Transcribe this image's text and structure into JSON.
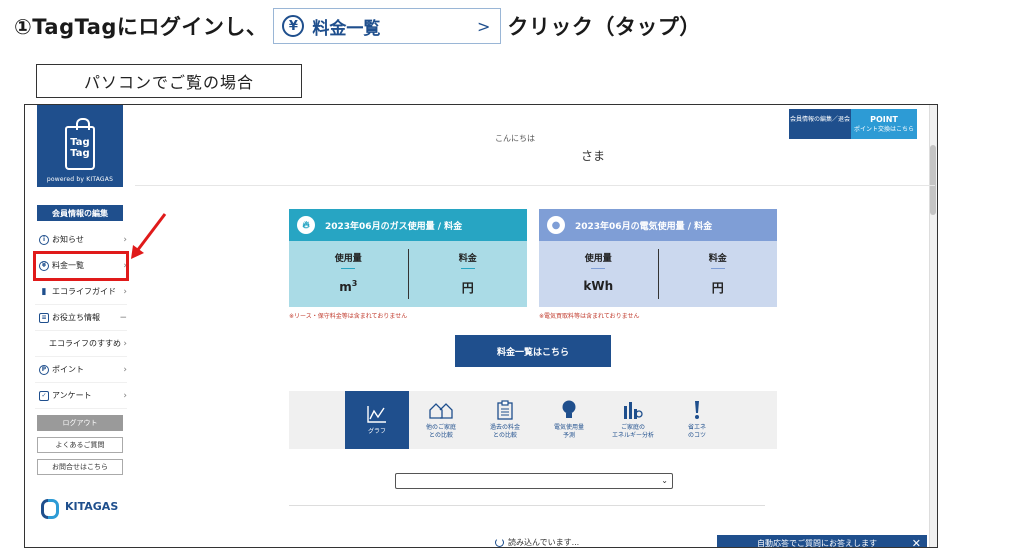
{
  "instruction": {
    "prefix": "①TagTagにログインし、",
    "button_label": "料金一覧",
    "button_chevron": ">",
    "suffix": "クリック（タップ）"
  },
  "pc_label": "パソコンでご覧の場合",
  "sidebar": {
    "logo_line1": "Tag",
    "logo_line2": "Tag",
    "powered": "powered by KITAGAS",
    "member_edit": "会員情報の編集",
    "items": [
      {
        "label": "お知らせ",
        "icon": "info-icon"
      },
      {
        "label": "料金一覧",
        "icon": "yen-icon"
      },
      {
        "label": "エコライフガイド",
        "icon": "bar-chart-icon"
      },
      {
        "label": "お役立ち情報",
        "icon": "document-icon",
        "marker": "−"
      },
      {
        "label": "エコライフのすすめ",
        "icon": ""
      },
      {
        "label": "ポイント",
        "icon": "point-icon"
      },
      {
        "label": "アンケート",
        "icon": "survey-icon"
      }
    ],
    "logout": "ログアウト",
    "faq": "よくあるご質問",
    "contact": "お問合せはこちら",
    "brand": "KITAGAS"
  },
  "header": {
    "member_btn": "会員情報の編集／退会",
    "point_btn_title": "POINT",
    "point_btn_sub": "ポイント交換はこちら",
    "greeting": "こんにちは",
    "name_suffix": "さま"
  },
  "gas_card": {
    "title": "2023年06月のガス使用量 / 料金",
    "usage_label": "使用量",
    "fee_label": "料金",
    "usage_unit": "m",
    "usage_sup": "3",
    "fee_unit": "円",
    "note": "※リース・保守料金等は含まれておりません"
  },
  "elec_card": {
    "title": "2023年06月の電気使用量 / 料金",
    "usage_label": "使用量",
    "fee_label": "料金",
    "usage_unit": "kWh",
    "fee_unit": "円",
    "note": "※電気買取料等は含まれておりません"
  },
  "main_button": "料金一覧はこちら",
  "tabs": [
    {
      "line1": "グラフ",
      "line2": "",
      "icon": "line-graph-icon"
    },
    {
      "line1": "他のご家庭",
      "line2": "との比較",
      "icon": "houses-icon"
    },
    {
      "line1": "過去の料金",
      "line2": "との比較",
      "icon": "clipboard-icon"
    },
    {
      "line1": "電気使用量",
      "line2": "予測",
      "icon": "bulb-icon"
    },
    {
      "line1": "ご家庭の",
      "line2": "エネルギー分析",
      "icon": "analysis-icon"
    },
    {
      "line1": "省エネ",
      "line2": "のコツ",
      "icon": "exclamation-icon"
    }
  ],
  "loading": "読み込んでいます...",
  "chat": "自動応答でご質問にお答えします",
  "chat_close": "✕",
  "colors": {
    "brand_navy": "#1f4f8d",
    "gas_teal": "#27a5c3",
    "elec_blue": "#7f9ed6",
    "highlight_red": "#e01a1a"
  }
}
